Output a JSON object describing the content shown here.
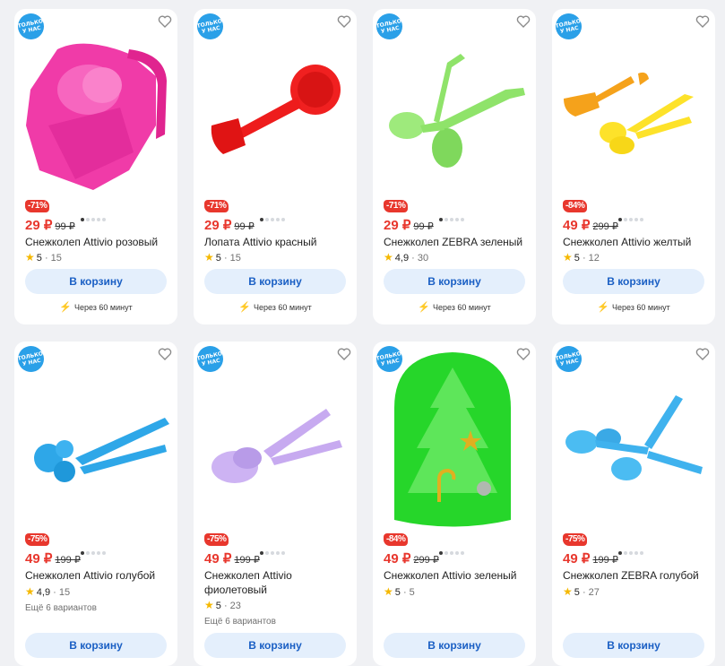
{
  "badge_text": "ТОЛЬКО У НАС",
  "cart_label": "В корзину",
  "delivery_text": "Через 60 минут",
  "products": [
    {
      "discount": "-71%",
      "price": "29 ₽",
      "old_price": "99 ₽",
      "title": "Снежколеп Attivio розовый",
      "rating": "5",
      "reviews": "15",
      "color": "#f03ba8"
    },
    {
      "discount": "-71%",
      "price": "29 ₽",
      "old_price": "99 ₽",
      "title": "Лопата Attivio красный",
      "rating": "5",
      "reviews": "15",
      "color": "#ee1c1c"
    },
    {
      "discount": "-71%",
      "price": "29 ₽",
      "old_price": "99 ₽",
      "title": "Снежколеп ZEBRA зеленый",
      "rating": "4,9",
      "reviews": "30",
      "color": "#8fe36a"
    },
    {
      "discount": "-84%",
      "price": "49 ₽",
      "old_price": "299 ₽",
      "title": "Снежколеп Attivio желтый",
      "rating": "5",
      "reviews": "12",
      "color": "#fde22a"
    },
    {
      "discount": "-75%",
      "price": "49 ₽",
      "old_price": "199 ₽",
      "title": "Снежколеп Attivio голубой",
      "rating": "4,9",
      "reviews": "15",
      "variants": "Ещё 6 вариантов",
      "color": "#2ea7e8"
    },
    {
      "discount": "-75%",
      "price": "49 ₽",
      "old_price": "199 ₽",
      "title": "Снежколеп Attivio фиолетовый",
      "rating": "5",
      "reviews": "23",
      "variants": "Ещё 6 вариантов",
      "color": "#c7aaf0"
    },
    {
      "discount": "-84%",
      "price": "49 ₽",
      "old_price": "299 ₽",
      "title": "Снежколеп Attivio зеленый",
      "rating": "5",
      "reviews": "5",
      "color": "#26d62a"
    },
    {
      "discount": "-75%",
      "price": "49 ₽",
      "old_price": "199 ₽",
      "title": "Снежколеп ZEBRA голубой",
      "rating": "5",
      "reviews": "27",
      "color": "#3fb2ee"
    }
  ]
}
